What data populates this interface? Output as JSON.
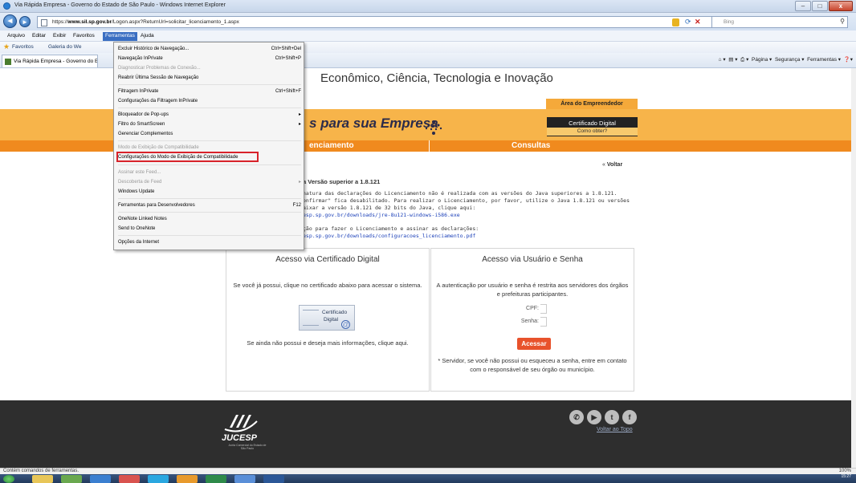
{
  "window": {
    "title": "Via Rápida Empresa - Governo do Estado de São Paulo - Windows Internet Explorer",
    "minimize": "–",
    "maximize": "□",
    "close": "x"
  },
  "address": {
    "back": "◄",
    "forward": "►",
    "url_prefix": "https://",
    "url_domain": "www.sil.sp.gov.br",
    "url_path": "/Logon.aspx?ReturnUrl=solicitar_licenciamento_1.aspx",
    "search_placeholder": "Bing"
  },
  "menubar": {
    "items": [
      "Arquivo",
      "Editar",
      "Exibir",
      "Favoritos",
      "Ferramentas",
      "Ajuda"
    ],
    "active_index": 4
  },
  "favorites": {
    "label": "Favoritos",
    "links": [
      "Galeria do We"
    ]
  },
  "tabs": [
    {
      "label": "Via Rápida Empresa - Governo do E"
    }
  ],
  "command_bar": {
    "items": [
      "Página ▾",
      "Segurança ▾",
      "Ferramentas ▾"
    ]
  },
  "tools_menu": {
    "items": [
      {
        "label": "Excluir Histórico de Navegação...",
        "shortcut": "Ctrl+Shift+Del",
        "disabled": false
      },
      {
        "label": "Navegação InPrivate",
        "shortcut": "Ctrl+Shift+P",
        "disabled": false
      },
      {
        "label": "Diagnosticar Problemas de Conexão...",
        "shortcut": "",
        "disabled": true
      },
      {
        "label": "Reabrir Última Sessão de Navegação",
        "shortcut": "",
        "disabled": false
      },
      {
        "label": "Filtragem InPrivate",
        "shortcut": "Ctrl+Shift+F",
        "disabled": false
      },
      {
        "label": "Configurações da Filtragem InPrivate",
        "shortcut": "",
        "disabled": false
      },
      {
        "label": "Bloqueador de Pop-ups",
        "shortcut": "",
        "submenu": true,
        "disabled": false
      },
      {
        "label": "Filtro do SmartScreen",
        "shortcut": "",
        "submenu": true,
        "disabled": false
      },
      {
        "label": "Gerenciar Complementos",
        "shortcut": "",
        "disabled": false
      },
      {
        "label": "Modo de Exibição de Compatibilidade",
        "shortcut": "",
        "disabled": true
      },
      {
        "label": "Configurações do Modo de Exibição de Compatibilidade",
        "shortcut": "",
        "disabled": false,
        "highlighted": true
      },
      {
        "label": "Assinar este Feed...",
        "shortcut": "",
        "disabled": true
      },
      {
        "label": "Descoberta de Feed",
        "shortcut": "",
        "submenu": true,
        "disabled": true
      },
      {
        "label": "Windows Update",
        "shortcut": "",
        "disabled": false
      },
      {
        "label": "Ferramentas para Desenvolvedores",
        "shortcut": "F12",
        "disabled": false
      },
      {
        "label": "OneNote Linked Notes",
        "shortcut": "",
        "disabled": false
      },
      {
        "label": "Send to OneNote",
        "shortcut": "",
        "disabled": false
      },
      {
        "label": "Opções da Internet",
        "shortcut": "",
        "disabled": false
      }
    ],
    "highlight_color": "#d8222a"
  },
  "page": {
    "header_title": "Econômico, Ciência, Tecnologia e Inovação",
    "area_empreendedor": "Área do Empreendedor",
    "banner_text": "s para sua Empresa",
    "cert_digital": "Certificado Digital",
    "como_obter": "Como obter?",
    "nav_licenciamento": "enciamento",
    "nav_consultas": "Consultas",
    "voltar": "Voltar",
    "voltar_arrow": "«",
    "java_heading": "a Versão superior a 1.8.121",
    "java_lines": [
      "natura das declarações do Licenciamento não é realizada com as versões do Java superiores a 1.8.121.",
      "onfirmar\" fica desabilitado. Para realizar o Licenciamento, por favor, utilize o Java 1.8.121 ou versões",
      "aixar a versão 1.8.121 de 32 bits do Java, clique aqui:",
      "esp.sp.gov.br/downloads/jre-8u121-windows-i586.exe",
      "ção para fazer o Licenciamento e assinar as declarações:",
      "esp.sp.gov.br/downloads/configuracoes_licenciamento.pdf"
    ],
    "panel_left": {
      "title": "Acesso via Certificado Digital",
      "text1": "Se você já possui, clique no certificado abaixo para acessar o sistema.",
      "cert_line1": "Certificado",
      "cert_line2": "Digital",
      "text2": "Se ainda não possui e deseja mais informações, clique aqui."
    },
    "panel_right": {
      "title": "Acesso via Usuário e Senha",
      "text1": "A autenticação por usuário e senha é restrita aos servidores dos órgãos e prefeituras participantes.",
      "cpf_label": "CPF:",
      "senha_label": "Senha:",
      "button": "Acessar",
      "text2": "* Servidor, se você não possui ou esqueceu a senha, entre em contato com o responsável de seu órgão ou município."
    }
  },
  "footer": {
    "logo_name": "JUCESP",
    "logo_sub": "Junta Comercial do Estado de São Paulo",
    "social": [
      "phone-icon",
      "youtube-icon",
      "twitter-icon",
      "facebook-icon"
    ],
    "voltar_topo": "Voltar ao Topo"
  },
  "statusbar": {
    "text": "Contém comandos de ferramentas.",
    "zoom": "100%"
  },
  "taskbar": {
    "time": "15:27"
  },
  "colors": {
    "orange_band": "#f7b44a",
    "nav_orange": "#f08a1e",
    "button_red": "#e8522c",
    "footer_dark": "#2e2e2e"
  }
}
